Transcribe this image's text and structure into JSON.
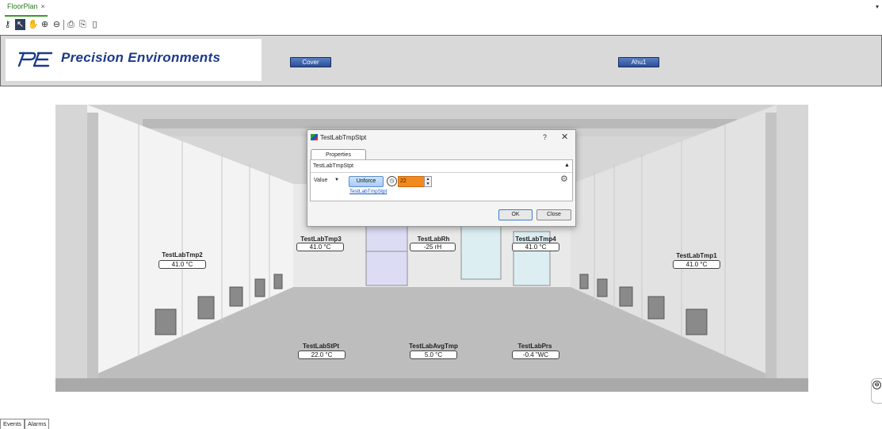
{
  "tabs": [
    {
      "label": "FloorPlan",
      "close": "×"
    }
  ],
  "toolbar": {
    "icons": [
      "key-icon",
      "select-icon",
      "pan-icon",
      "zoom-in-icon",
      "zoom-out-icon",
      "print-icon",
      "print-preview-icon",
      "document-icon"
    ]
  },
  "header": {
    "logo_mark": "PE",
    "logo_text": "Precision Environments",
    "buttons": {
      "cover": "Cover",
      "ahu": "Ahu1"
    },
    "background": "#d9d9d9"
  },
  "sensors": [
    {
      "id": "tmp2",
      "name": "TestLabTmp2",
      "value": "41.0 °C"
    },
    {
      "id": "tmp3",
      "name": "TestLabTmp3",
      "value": "41.0 °C"
    },
    {
      "id": "rh",
      "name": "TestLabRh",
      "value": "-25 rH"
    },
    {
      "id": "tmp4",
      "name": "TestLabTmp4",
      "value": "41.0 °C"
    },
    {
      "id": "tmp1",
      "name": "TestLabTmp1",
      "value": "41.0 °C"
    },
    {
      "id": "stpt",
      "name": "TestLabStPt",
      "value": "22.0 °C"
    },
    {
      "id": "avg",
      "name": "TestLabAvgTmp",
      "value": "5.0 °C"
    },
    {
      "id": "prs",
      "name": "TestLabPrs",
      "value": "-0.4 \"WC"
    }
  ],
  "dialog": {
    "title": "TestLabTmpStpt",
    "help": "?",
    "close_glyph": "✕",
    "tab": "Properties",
    "object_name": "TestLabTmpStpt",
    "value_label": "Value",
    "unforce": "Unforce",
    "value": "22",
    "link": "TestLabTmpStpt",
    "ok": "OK",
    "close": "Close",
    "value_color": "#f28a1f"
  },
  "bottom_tabs": {
    "events": "Events",
    "alarms": "Alarms"
  }
}
